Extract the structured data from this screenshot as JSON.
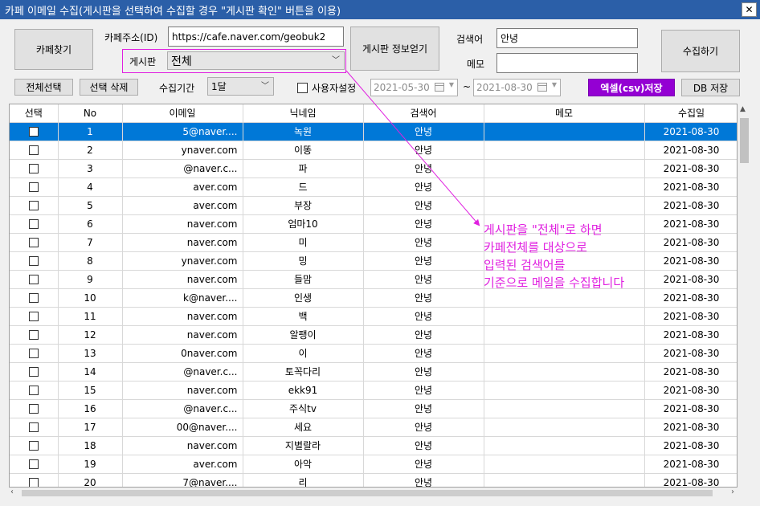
{
  "window": {
    "title": "카페 이메일 수집(게시판을 선택하여 수집할 경우 \"게시판 확인\" 버튼을 이용)",
    "close_label": "✕"
  },
  "toolbar": {
    "find_cafe_label": "카페찾기",
    "cafe_address_label": "카페주소(ID)",
    "cafe_address_value": "https://cafe.naver.com/geobuk2",
    "board_label": "게시판",
    "board_selected": "전체",
    "board_info_label": "게시판 정보얻기",
    "search_term_label": "검색어",
    "search_term_value": "안녕",
    "memo_label": "메모",
    "memo_value": "",
    "collect_label": "수집하기",
    "select_all_label": "전체선택",
    "delete_selected_label": "선택 삭제",
    "period_label": "수집기간",
    "period_selected": "1달",
    "user_setting_label": "사용자설정",
    "date_from": "2021-05-30",
    "date_sep": "~",
    "date_to": "2021-08-30",
    "excel_save_label": "엑셀(csv)저장",
    "db_save_label": "DB 저장"
  },
  "table": {
    "headers": [
      "선택",
      "No",
      "이메일",
      "닉네임",
      "검색어",
      "메모",
      "수집일"
    ],
    "rows": [
      {
        "no": "1",
        "email": "5@naver....",
        "nick": "녹원",
        "term": "안녕",
        "memo": "",
        "date": "2021-08-30"
      },
      {
        "no": "2",
        "email": "ynaver.com",
        "nick": "이똥",
        "term": "안녕",
        "memo": "",
        "date": "2021-08-30"
      },
      {
        "no": "3",
        "email": "@naver.c...",
        "nick": "파",
        "term": "안녕",
        "memo": "",
        "date": "2021-08-30"
      },
      {
        "no": "4",
        "email": "aver.com",
        "nick": "드",
        "term": "안녕",
        "memo": "",
        "date": "2021-08-30"
      },
      {
        "no": "5",
        "email": "aver.com",
        "nick": "부장",
        "term": "안녕",
        "memo": "",
        "date": "2021-08-30"
      },
      {
        "no": "6",
        "email": "naver.com",
        "nick": "엄마10",
        "term": "안녕",
        "memo": "",
        "date": "2021-08-30"
      },
      {
        "no": "7",
        "email": "naver.com",
        "nick": "미",
        "term": "안녕",
        "memo": "",
        "date": "2021-08-30"
      },
      {
        "no": "8",
        "email": "ynaver.com",
        "nick": "밍",
        "term": "안녕",
        "memo": "",
        "date": "2021-08-30"
      },
      {
        "no": "9",
        "email": "naver.com",
        "nick": "들맘",
        "term": "안녕",
        "memo": "",
        "date": "2021-08-30"
      },
      {
        "no": "10",
        "email": "k@naver....",
        "nick": "인생",
        "term": "안녕",
        "memo": "",
        "date": "2021-08-30"
      },
      {
        "no": "11",
        "email": "naver.com",
        "nick": "백",
        "term": "안녕",
        "memo": "",
        "date": "2021-08-30"
      },
      {
        "no": "12",
        "email": "naver.com",
        "nick": "알팽이",
        "term": "안녕",
        "memo": "",
        "date": "2021-08-30"
      },
      {
        "no": "13",
        "email": "0naver.com",
        "nick": "이",
        "term": "안녕",
        "memo": "",
        "date": "2021-08-30"
      },
      {
        "no": "14",
        "email": "@naver.c...",
        "nick": "토꼭다리",
        "term": "안녕",
        "memo": "",
        "date": "2021-08-30"
      },
      {
        "no": "15",
        "email": "naver.com",
        "nick": "ekk91",
        "term": "안녕",
        "memo": "",
        "date": "2021-08-30"
      },
      {
        "no": "16",
        "email": "@naver.c...",
        "nick": "주식tv",
        "term": "안녕",
        "memo": "",
        "date": "2021-08-30"
      },
      {
        "no": "17",
        "email": "00@naver....",
        "nick": "세요",
        "term": "안녕",
        "memo": "",
        "date": "2021-08-30"
      },
      {
        "no": "18",
        "email": "naver.com",
        "nick": "지별랄라",
        "term": "안녕",
        "memo": "",
        "date": "2021-08-30"
      },
      {
        "no": "19",
        "email": "aver.com",
        "nick": "아악",
        "term": "안녕",
        "memo": "",
        "date": "2021-08-30"
      },
      {
        "no": "20",
        "email": "7@naver....",
        "nick": "리",
        "term": "안녕",
        "memo": "",
        "date": "2021-08-30"
      }
    ]
  },
  "annotation": {
    "lines": [
      "게시판을 \"전체\"로 하면",
      "카페전체를 대상으로",
      "입력된 검색어를",
      "기준으로 메일을 수집합니다"
    ]
  },
  "colors": {
    "selection": "#0078d7",
    "accent_button": "#9400d3",
    "annotation": "#e020e0"
  }
}
